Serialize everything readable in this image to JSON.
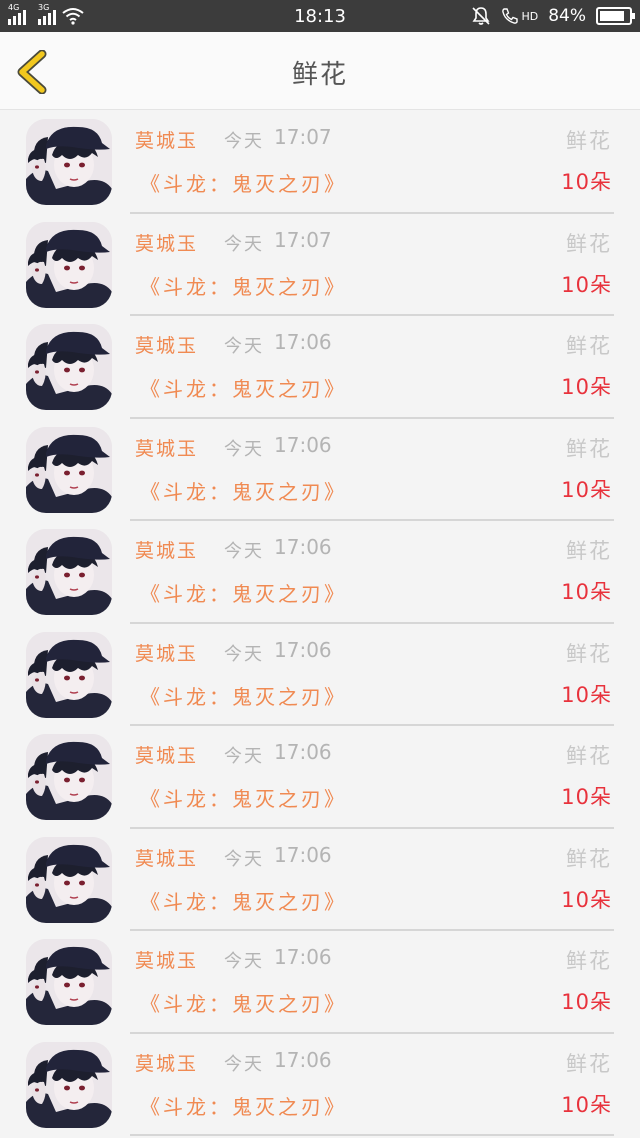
{
  "status_bar": {
    "network1": "4G",
    "network2": "3G",
    "time": "18:13",
    "hd": "HD",
    "battery": "84%",
    "battery_level": 0.84
  },
  "nav": {
    "title": "鲜花"
  },
  "records": [
    {
      "name": "莫城玉",
      "day": "今天",
      "time": "17:07",
      "type": "鲜花",
      "book": "《斗龙：鬼灭之刃》",
      "amount": "10朵"
    },
    {
      "name": "莫城玉",
      "day": "今天",
      "time": "17:07",
      "type": "鲜花",
      "book": "《斗龙：鬼灭之刃》",
      "amount": "10朵"
    },
    {
      "name": "莫城玉",
      "day": "今天",
      "time": "17:06",
      "type": "鲜花",
      "book": "《斗龙：鬼灭之刃》",
      "amount": "10朵"
    },
    {
      "name": "莫城玉",
      "day": "今天",
      "time": "17:06",
      "type": "鲜花",
      "book": "《斗龙：鬼灭之刃》",
      "amount": "10朵"
    },
    {
      "name": "莫城玉",
      "day": "今天",
      "time": "17:06",
      "type": "鲜花",
      "book": "《斗龙：鬼灭之刃》",
      "amount": "10朵"
    },
    {
      "name": "莫城玉",
      "day": "今天",
      "time": "17:06",
      "type": "鲜花",
      "book": "《斗龙：鬼灭之刃》",
      "amount": "10朵"
    },
    {
      "name": "莫城玉",
      "day": "今天",
      "time": "17:06",
      "type": "鲜花",
      "book": "《斗龙：鬼灭之刃》",
      "amount": "10朵"
    },
    {
      "name": "莫城玉",
      "day": "今天",
      "time": "17:06",
      "type": "鲜花",
      "book": "《斗龙：鬼灭之刃》",
      "amount": "10朵"
    },
    {
      "name": "莫城玉",
      "day": "今天",
      "time": "17:06",
      "type": "鲜花",
      "book": "《斗龙：鬼灭之刃》",
      "amount": "10朵"
    },
    {
      "name": "莫城玉",
      "day": "今天",
      "time": "17:06",
      "type": "鲜花",
      "book": "《斗龙：鬼灭之刃》",
      "amount": "10朵"
    }
  ],
  "colors": {
    "accent_orange": "#f08a52",
    "amount_red": "#e8323c",
    "back_arrow_yellow": "#f2c81e",
    "status_bar_bg": "#3c3c3c"
  },
  "icons": {
    "back": "chevron-left-icon",
    "wifi": "wifi-icon",
    "mute": "bell-off-icon",
    "call": "phone-icon",
    "battery": "battery-icon"
  }
}
